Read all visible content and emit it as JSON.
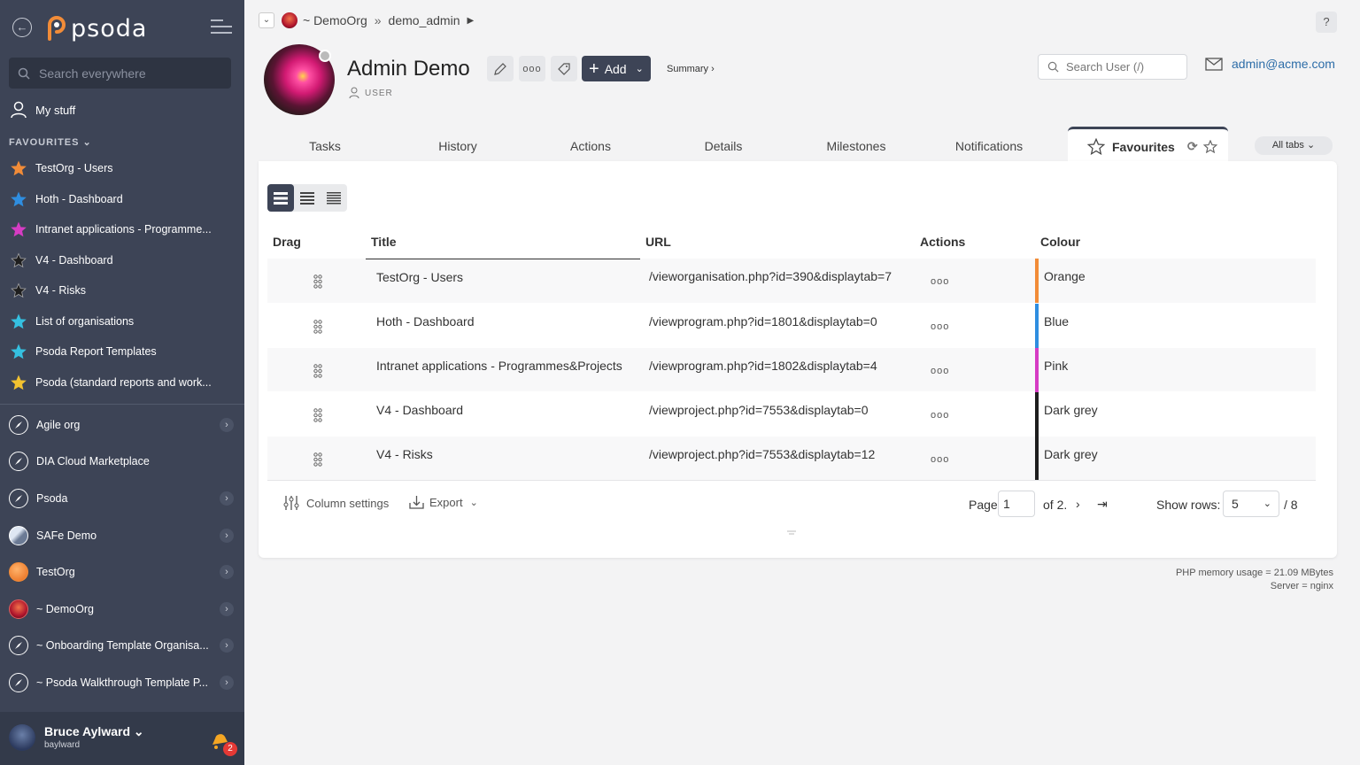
{
  "sidebar": {
    "logo_text": "psoda",
    "search_placeholder": "Search everywhere",
    "my_stuff": "My stuff",
    "favourites_heading": "FAVOURITES",
    "favourites": [
      {
        "label": "TestOrg - Users",
        "color": "#f28c38"
      },
      {
        "label": "Hoth - Dashboard",
        "color": "#2f8ee0"
      },
      {
        "label": "Intranet applications - Programme...",
        "color": "#d63cc4"
      },
      {
        "label": "V4 - Dashboard",
        "color": "#1e1e1e"
      },
      {
        "label": "V4 - Risks",
        "color": "#1e1e1e"
      },
      {
        "label": "List of organisations",
        "color": "#35c0e0"
      },
      {
        "label": "Psoda Report Templates",
        "color": "#35c0e0"
      },
      {
        "label": "Psoda (standard reports and work...",
        "color": "#f2c230"
      }
    ],
    "organisations": [
      {
        "label": "Agile org",
        "icon": "compass-icon",
        "chevron": true
      },
      {
        "label": "DIA Cloud Marketplace",
        "icon": "compass-icon",
        "chevron": false
      },
      {
        "label": "Psoda",
        "icon": "compass-icon",
        "chevron": true
      },
      {
        "label": "SAFe Demo",
        "icon": "mountain-icon",
        "chevron": true
      },
      {
        "label": "TestOrg",
        "icon": "orange-ball-icon",
        "chevron": true
      },
      {
        "label": "~ DemoOrg",
        "icon": "sunset-icon",
        "chevron": true
      },
      {
        "label": "~ Onboarding Template Organisa...",
        "icon": "compass-icon",
        "chevron": true
      },
      {
        "label": "~ Psoda Walkthrough Template P...",
        "icon": "compass-icon",
        "chevron": true
      }
    ],
    "user": {
      "name": "Bruce Aylward",
      "handle": "baylward",
      "notifications": "2"
    }
  },
  "header": {
    "breadcrumb_org": "~ DemoOrg",
    "breadcrumb_sep": "»",
    "breadcrumb_user": "demo_admin",
    "help": "?"
  },
  "profile": {
    "name": "Admin Demo",
    "role": "USER",
    "add_label": "Add",
    "summary_label": "Summary ›",
    "user_search_placeholder": "Search User (/)",
    "email": "admin@acme.com"
  },
  "tabs": {
    "items": [
      "Tasks",
      "History",
      "Actions",
      "Details",
      "Milestones",
      "Notifications"
    ],
    "active": "Favourites",
    "all_tabs": "All tabs ⌄"
  },
  "table": {
    "headers": {
      "drag": "Drag",
      "title": "Title",
      "url": "URL",
      "actions": "Actions",
      "colour": "Colour"
    },
    "rows": [
      {
        "title": "TestOrg - Users",
        "url": "/vieworganisation.php?id=390&displaytab=7",
        "colour": "Orange",
        "hex": "#f28c38"
      },
      {
        "title": "Hoth - Dashboard",
        "url": "/viewprogram.php?id=1801&displaytab=0",
        "colour": "Blue",
        "hex": "#2f8ee0"
      },
      {
        "title": "Intranet applications - Programmes&Projects",
        "url": "/viewprogram.php?id=1802&displaytab=4",
        "colour": "Pink",
        "hex": "#d63cc4"
      },
      {
        "title": "V4 - Dashboard",
        "url": "/viewproject.php?id=7553&displaytab=0",
        "colour": "Dark grey",
        "hex": "#1e1e1e"
      },
      {
        "title": "V4 - Risks",
        "url": "/viewproject.php?id=7553&displaytab=12",
        "colour": "Dark grey",
        "hex": "#1e1e1e"
      }
    ]
  },
  "pager": {
    "column_settings": "Column settings",
    "export": "Export",
    "page_label": "Page",
    "page_value": "1",
    "of_label": "of 2.",
    "rows_label": "Show rows:",
    "rows_value": "5",
    "total": "/ 8"
  },
  "footer": {
    "memory": "PHP memory usage = 21.09 MBytes",
    "server": "Server = nginx"
  }
}
